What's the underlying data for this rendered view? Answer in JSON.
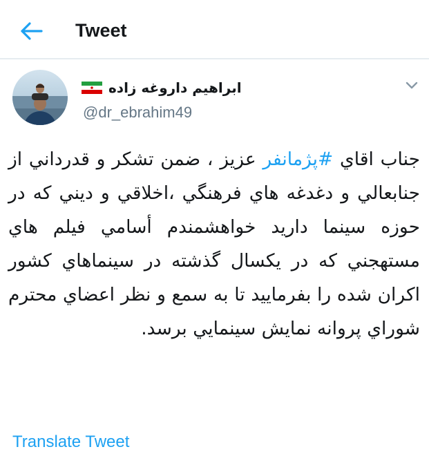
{
  "header": {
    "title": "Tweet",
    "back_icon": "arrow-left-icon"
  },
  "author": {
    "display_name": "ابراهیم داروغه زاده",
    "handle": "@dr_ebrahim49",
    "flag_icon": "iran-flag-icon"
  },
  "tweet": {
    "text_before_hashtag": "جناب اقاي ",
    "hashtag": "#پژمانفر",
    "text_after_hashtag": " عزيز ، ضمن تشكر و قدرداني از جنابعالي و دغدغه هاي فرهنگي ،اخلاقي و ديني كه در حوزه سينما داريد خواهشمندم أسامي فيلم هاي مستهجني كه در يكسال گذشته در سينماهاي كشور اكران شده را بفرماييد تا به سمع و نظر اعضاي محترم شوراي پروانه نمايش سينمايي برسد."
  },
  "actions": {
    "translate_label": "Translate Tweet",
    "more_icon": "chevron-down-icon"
  },
  "colors": {
    "accent": "#1da1f2",
    "text": "#14171a",
    "secondary_text": "#657786",
    "divider": "#e6ecf0"
  }
}
